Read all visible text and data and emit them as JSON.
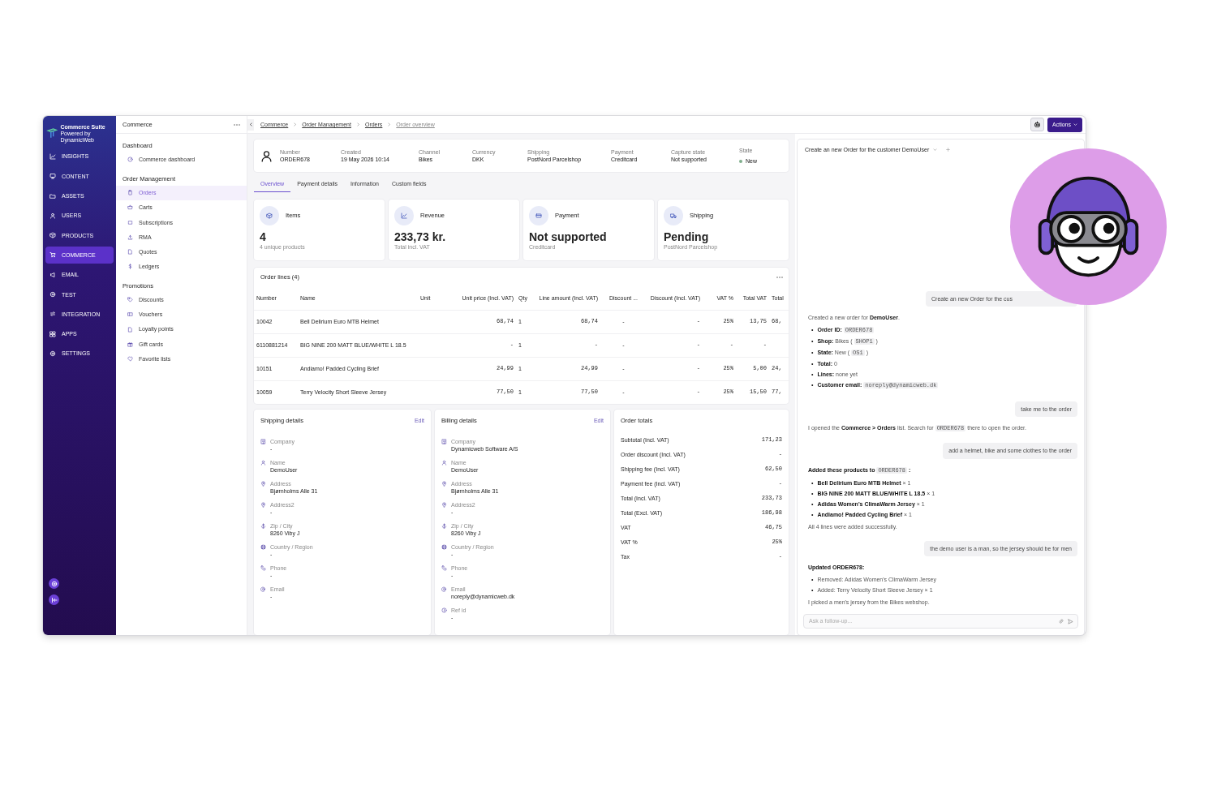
{
  "app": {
    "brand": "Commerce Suite",
    "brand_sub": "Powered by DynamicWeb"
  },
  "main_nav": [
    {
      "label": "INSIGHTS",
      "selected": false
    },
    {
      "label": "CONTENT",
      "selected": false
    },
    {
      "label": "ASSETS",
      "selected": false
    },
    {
      "label": "USERS",
      "selected": false
    },
    {
      "label": "PRODUCTS",
      "selected": false
    },
    {
      "label": "COMMERCE",
      "selected": true
    },
    {
      "label": "EMAIL",
      "selected": false
    },
    {
      "label": "TEST",
      "selected": false
    },
    {
      "label": "INTEGRATION",
      "selected": false
    },
    {
      "label": "APPS",
      "selected": false
    },
    {
      "label": "SETTINGS",
      "selected": false
    }
  ],
  "section_panel": {
    "title": "Commerce",
    "groups": [
      {
        "title": "Dashboard",
        "items": [
          {
            "label": "Commerce dashboard",
            "selected": false
          }
        ]
      },
      {
        "title": "Order Management",
        "items": [
          {
            "label": "Orders",
            "selected": true
          },
          {
            "label": "Carts",
            "selected": false
          },
          {
            "label": "Subscriptions",
            "selected": false
          },
          {
            "label": "RMA",
            "selected": false
          },
          {
            "label": "Quotes",
            "selected": false
          },
          {
            "label": "Ledgers",
            "selected": false
          }
        ]
      },
      {
        "title": "Promotions",
        "items": [
          {
            "label": "Discounts",
            "selected": false
          },
          {
            "label": "Vouchers",
            "selected": false
          },
          {
            "label": "Loyalty points",
            "selected": false
          },
          {
            "label": "Gift cards",
            "selected": false
          },
          {
            "label": "Favorite lists",
            "selected": false
          }
        ]
      }
    ]
  },
  "breadcrumbs": [
    "Commerce",
    "Order Management",
    "Orders",
    "Order overview"
  ],
  "actions_button": "Actions",
  "order_header": {
    "fields": [
      {
        "label": "Number",
        "value": "ORDER678"
      },
      {
        "label": "Created",
        "value": "19 May 2026 10:14"
      },
      {
        "label": "Channel",
        "value": "Bikes"
      },
      {
        "label": "Currency",
        "value": "DKK"
      },
      {
        "label": "Shipping",
        "value": "PostNord Parcelshop"
      },
      {
        "label": "Payment",
        "value": "Creditcard"
      },
      {
        "label": "Capture state",
        "value": "Not supported"
      }
    ],
    "state": {
      "label": "State",
      "value": "New",
      "color": "#7fae8c"
    }
  },
  "tabs": [
    {
      "label": "Overview",
      "selected": true
    },
    {
      "label": "Payment details",
      "selected": false
    },
    {
      "label": "Information",
      "selected": false
    },
    {
      "label": "Custom fields",
      "selected": false
    }
  ],
  "kpis": [
    {
      "title": "Items",
      "value": "4",
      "sub": "4 unique products"
    },
    {
      "title": "Revenue",
      "value": "233,73 kr.",
      "sub": "Total incl. VAT"
    },
    {
      "title": "Payment",
      "value": "Not supported",
      "sub": "Creditcard"
    },
    {
      "title": "Shipping",
      "value": "Pending",
      "sub": "PostNord Parcelshop"
    }
  ],
  "order_lines": {
    "title": "Order lines (4)",
    "columns": [
      "Number",
      "Name",
      "Unit",
      "Unit price (Incl. VAT)",
      "Qty",
      "Line amount (Incl. VAT)",
      "Discount ...",
      "Discount (Incl. VAT)",
      "VAT %",
      "Total VAT",
      "Total"
    ],
    "rows": [
      [
        "10042",
        "Bell Delirium Euro MTB Helmet",
        "",
        "68,74",
        "1",
        "68,74",
        "-",
        "-",
        "25%",
        "13,75",
        "68,"
      ],
      [
        "6110881214",
        "BIG NINE 200 MATT BLUE/WHITE L 18.5",
        "",
        "-",
        "1",
        "-",
        "-",
        "-",
        "-",
        "-",
        ""
      ],
      [
        "10151",
        "Andiamo! Padded Cycling Brief",
        "",
        "24,99",
        "1",
        "24,99",
        "-",
        "-",
        "25%",
        "5,00",
        "24,"
      ],
      [
        "10059",
        "Terry Velocity Short Sleeve Jersey",
        "",
        "77,50",
        "1",
        "77,50",
        "-",
        "-",
        "25%",
        "15,50",
        "77,"
      ]
    ]
  },
  "shipping_details": {
    "title": "Shipping details",
    "edit": "Edit",
    "fields": [
      {
        "label": "Company",
        "value": "-"
      },
      {
        "label": "Name",
        "value": "DemoUser"
      },
      {
        "label": "Address",
        "value": "Bjørnholms Alle 31"
      },
      {
        "label": "Address2",
        "value": "-"
      },
      {
        "label": "Zip / City",
        "value": "8260 Viby J"
      },
      {
        "label": "Country / Region",
        "value": "-"
      },
      {
        "label": "Phone",
        "value": "-"
      },
      {
        "label": "Email",
        "value": "-"
      }
    ]
  },
  "billing_details": {
    "title": "Billing details",
    "edit": "Edit",
    "fields": [
      {
        "label": "Company",
        "value": "Dynamicweb Software A/S"
      },
      {
        "label": "Name",
        "value": "DemoUser"
      },
      {
        "label": "Address",
        "value": "Bjørnholms Alle 31"
      },
      {
        "label": "Address2",
        "value": "-"
      },
      {
        "label": "Zip / City",
        "value": "8260 Viby J"
      },
      {
        "label": "Country / Region",
        "value": "-"
      },
      {
        "label": "Phone",
        "value": "-"
      },
      {
        "label": "Email",
        "value": "noreply@dynamicweb.dk"
      },
      {
        "label": "Ref id",
        "value": "-"
      }
    ]
  },
  "order_totals": {
    "title": "Order totals",
    "rows": [
      {
        "label": "Subtotal (Incl. VAT)",
        "value": "171,23"
      },
      {
        "label": "Order discount (Incl. VAT)",
        "value": "-"
      },
      {
        "label": "Shipping fee (Incl. VAT)",
        "value": "62,50"
      },
      {
        "label": "Payment fee (Incl. VAT)",
        "value": "-"
      },
      {
        "label": "Total (Incl. VAT)",
        "value": "233,73"
      },
      {
        "label": "Total (Excl. VAT)",
        "value": "186,98"
      },
      {
        "label": "VAT",
        "value": "46,75"
      },
      {
        "label": "VAT %",
        "value": "25%"
      },
      {
        "label": "Tax",
        "value": "-"
      }
    ]
  },
  "chat": {
    "thread_title": "Create an new Order for the customer DemoUser",
    "input_placeholder": "Ask a follow-up...",
    "messages": [
      {
        "kind": "user",
        "text": "Create an new Order for the cus",
        "cut_off": true
      },
      {
        "kind": "assistant",
        "blocks": [
          {
            "kind": "paragraph",
            "parts": [
              {
                "kind": "plain",
                "text": "Created a new order for "
              },
              {
                "kind": "bold",
                "text": "DemoUser"
              },
              {
                "kind": "plain",
                "text": "."
              }
            ]
          },
          {
            "kind": "list",
            "marker": "•",
            "items": [
              [
                {
                  "kind": "bold",
                  "text": "Order ID: "
                },
                {
                  "kind": "code",
                  "text": "ORDER678"
                }
              ],
              [
                {
                  "kind": "bold",
                  "text": "Shop: "
                },
                {
                  "kind": "plain",
                  "text": "Bikes ( "
                },
                {
                  "kind": "code",
                  "text": "SHOP1"
                },
                {
                  "kind": "plain",
                  "text": " )"
                }
              ],
              [
                {
                  "kind": "bold",
                  "text": "State: "
                },
                {
                  "kind": "plain",
                  "text": "New ( "
                },
                {
                  "kind": "code",
                  "text": "OS1"
                },
                {
                  "kind": "plain",
                  "text": " )"
                }
              ],
              [
                {
                  "kind": "bold",
                  "text": "Total: "
                },
                {
                  "kind": "plain",
                  "text": "0"
                }
              ],
              [
                {
                  "kind": "bold",
                  "text": "Lines: "
                },
                {
                  "kind": "plain",
                  "text": "none yet"
                }
              ],
              [
                {
                  "kind": "bold",
                  "text": "Customer email: "
                },
                {
                  "kind": "code",
                  "text": "noreply@dynamicweb.dk"
                }
              ]
            ]
          }
        ]
      },
      {
        "kind": "user",
        "text": "take me to the order",
        "cut_off": false
      },
      {
        "kind": "assistant",
        "blocks": [
          {
            "kind": "paragraph",
            "parts": [
              {
                "kind": "plain",
                "text": "I opened the "
              },
              {
                "kind": "bold",
                "text": "Commerce > Orders"
              },
              {
                "kind": "plain",
                "text": " list. Search for "
              },
              {
                "kind": "code",
                "text": "ORDER678"
              },
              {
                "kind": "plain",
                "text": " there to open the order."
              }
            ]
          }
        ]
      },
      {
        "kind": "user",
        "text": "add a helmet, bike and some clothes to the order",
        "cut_off": false
      },
      {
        "kind": "assistant",
        "blocks": [
          {
            "kind": "paragraph",
            "parts": [
              {
                "kind": "bold",
                "text": "Added these products to "
              },
              {
                "kind": "code",
                "text": "ORDER678"
              },
              {
                "kind": "bold",
                "text": " :"
              }
            ]
          },
          {
            "kind": "list",
            "marker": "•",
            "items": [
              [
                {
                  "kind": "bold",
                  "text": "Bell Delirium Euro MTB Helmet"
                },
                {
                  "kind": "plain",
                  "text": " × 1"
                }
              ],
              [
                {
                  "kind": "bold",
                  "text": "BIG NINE 200 MATT BLUE/WHITE L 18.5"
                },
                {
                  "kind": "plain",
                  "text": " × 1"
                }
              ],
              [
                {
                  "kind": "bold",
                  "text": "Adidas Women's ClimaWarm Jersey"
                },
                {
                  "kind": "plain",
                  "text": " × 1"
                }
              ],
              [
                {
                  "kind": "bold",
                  "text": "Andiamo! Padded Cycling Brief"
                },
                {
                  "kind": "plain",
                  "text": " × 1"
                }
              ]
            ]
          },
          {
            "kind": "paragraph",
            "parts": [
              {
                "kind": "plain",
                "text": "All 4 lines were added successfully."
              }
            ]
          }
        ]
      },
      {
        "kind": "user",
        "text": "the demo user is a man, so the jersey should be for men",
        "cut_off": false
      },
      {
        "kind": "assistant",
        "blocks": [
          {
            "kind": "paragraph",
            "parts": [
              {
                "kind": "bold",
                "text": "Updated ORDER678:"
              }
            ]
          },
          {
            "kind": "list",
            "marker": "•",
            "items": [
              [
                {
                  "kind": "plain",
                  "text": "Removed: Adidas Women's ClimaWarm Jersey"
                }
              ],
              [
                {
                  "kind": "plain",
                  "text": "Added: Terry Velocity Short Sleeve Jersey × 1"
                }
              ]
            ]
          },
          {
            "kind": "paragraph",
            "parts": [
              {
                "kind": "plain",
                "text": "I picked a men's jersey from the Bikes webshop."
              }
            ]
          }
        ]
      }
    ]
  }
}
